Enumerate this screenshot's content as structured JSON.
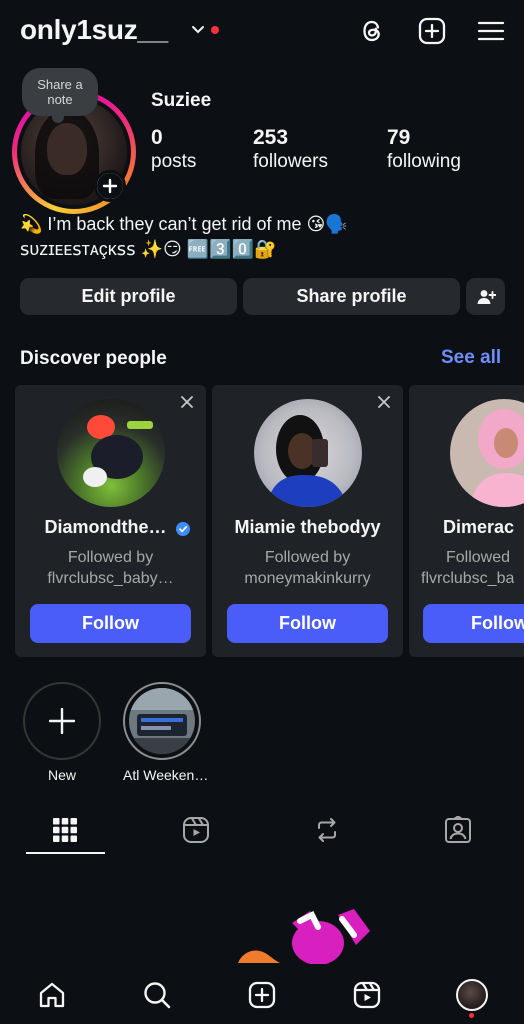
{
  "header": {
    "username": "only1suz__",
    "icons": [
      "chevron-down-icon",
      "threads-icon",
      "create-plus-icon",
      "menu-icon"
    ]
  },
  "profile": {
    "note_bubble": "Share a note",
    "display_name": "Suziee",
    "stats": {
      "posts": {
        "count": "0",
        "label": "posts"
      },
      "followers": {
        "count": "253",
        "label": "followers"
      },
      "following": {
        "count": "79",
        "label": "following"
      }
    },
    "bio_line1": "💫 I’m back they can’t get rid of me 😘🗣️",
    "bio_line2": "ꜱᴜᴢɪᴇᴇꜱᴛᴀçᴋꜱꜱ ✨😏 🆓3️⃣0️⃣🔐"
  },
  "actions": {
    "edit_profile": "Edit profile",
    "share_profile": "Share profile"
  },
  "discover": {
    "title": "Discover people",
    "see_all": "See all",
    "cards": [
      {
        "name": "Diamondthe…",
        "verified": true,
        "followed_by_label": "Followed by",
        "followed_by": "flvrclubsc_baby…",
        "follow_label": "Follow"
      },
      {
        "name": "Miamie thebodyy",
        "verified": false,
        "followed_by_label": "Followed by",
        "followed_by": "moneymakinkurry",
        "follow_label": "Follow"
      },
      {
        "name": "Dimerac",
        "verified": false,
        "followed_by_label": "Followed",
        "followed_by": "flvrclubsc_ba",
        "follow_label": "Follow"
      }
    ]
  },
  "highlights": [
    {
      "label": "New"
    },
    {
      "label": "Atl Weeken…"
    }
  ],
  "tabs": [
    "grid-icon",
    "reels-icon",
    "reposts-icon",
    "tagged-icon"
  ],
  "bottom_nav": [
    "home-icon",
    "search-icon",
    "create-icon",
    "reels-icon",
    "profile-avatar"
  ],
  "colors": {
    "background": "#0c1014",
    "button": "#26292e",
    "card": "#1f2226",
    "follow_button": "#4a5df9",
    "link": "#708dff",
    "notification": "#ff3040"
  }
}
